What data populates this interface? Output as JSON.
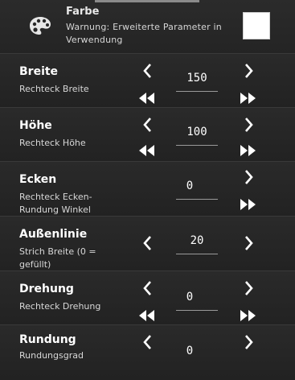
{
  "header": {
    "title": "Farbe",
    "warning": "Warnung: Erweiterte Parameter in Verwendung",
    "swatch_color": "#ffffff"
  },
  "rows": [
    {
      "label": "Breite",
      "sub": "Rechteck Breite",
      "value": "150"
    },
    {
      "label": "Höhe",
      "sub": "Rechteck Höhe",
      "value": "100"
    },
    {
      "label": "Ecken",
      "sub": "Rechteck Ecken-Rundung Winkel",
      "value": "0"
    },
    {
      "label": "Außenlinie",
      "sub": "Strich Breite (0 = gefüllt)",
      "value": "20"
    },
    {
      "label": "Drehung",
      "sub": "Rechteck Drehung",
      "value": "0"
    },
    {
      "label": "Rundung",
      "sub": "Rundungsgrad",
      "value": "0"
    }
  ],
  "icons": {
    "palette": "palette-icon",
    "decrement": "chevron-left-icon",
    "increment": "chevron-right-icon",
    "fast_decrement": "double-chevron-left-icon",
    "fast_increment": "double-chevron-right-icon"
  }
}
